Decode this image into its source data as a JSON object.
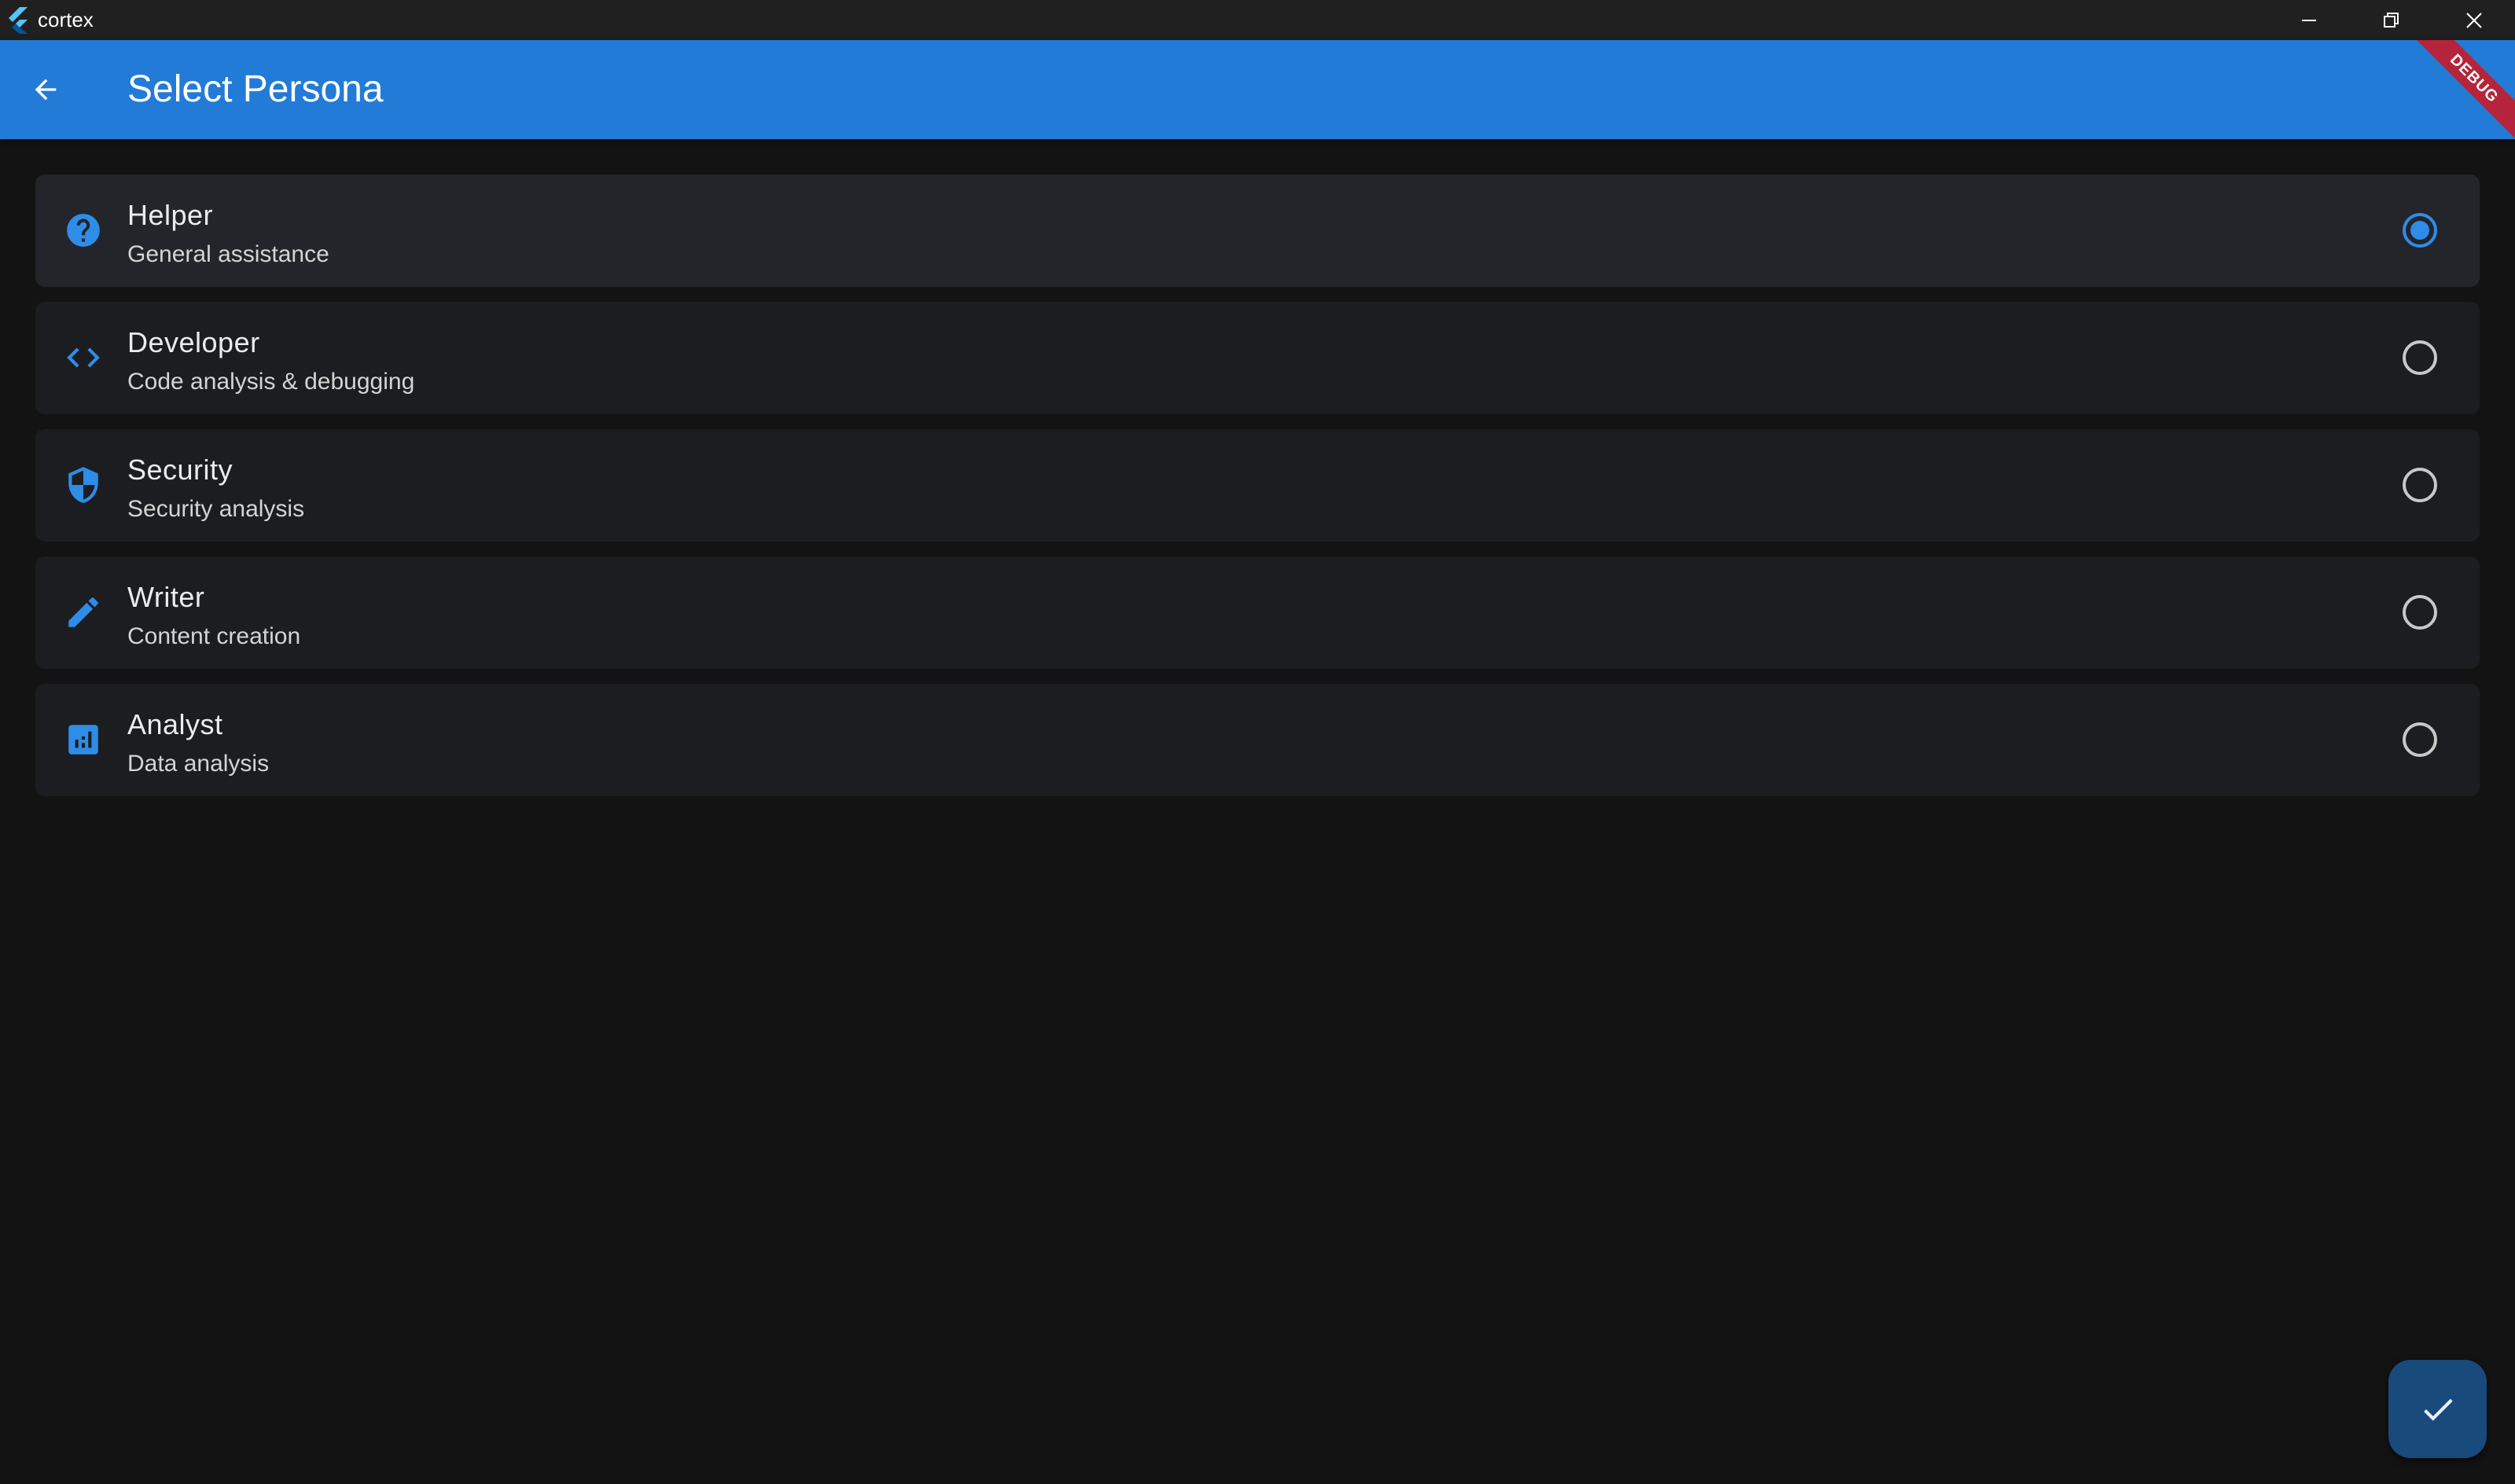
{
  "window": {
    "title": "cortex",
    "controls": [
      "minimize-icon",
      "restore-icon",
      "close-icon"
    ]
  },
  "appbar": {
    "title": "Select Persona",
    "back_icon": "arrow-back-icon",
    "debug_banner": "DEBUG",
    "color": "#227bd7"
  },
  "personas": [
    {
      "name": "Helper",
      "description": "General assistance",
      "icon": "help-circle-icon",
      "selected": true
    },
    {
      "name": "Developer",
      "description": "Code analysis & debugging",
      "icon": "code-icon",
      "selected": false
    },
    {
      "name": "Security",
      "description": "Security analysis",
      "icon": "shield-icon",
      "selected": false
    },
    {
      "name": "Writer",
      "description": "Content creation",
      "icon": "pencil-icon",
      "selected": false
    },
    {
      "name": "Analyst",
      "description": "Data analysis",
      "icon": "analytics-icon",
      "selected": false
    }
  ],
  "fab": {
    "icon": "check-icon"
  },
  "colors": {
    "accent": "#2e8de8",
    "background": "#131314",
    "card": "#1c1d21",
    "card_selected": "#23252a",
    "fab": "#184a7c"
  }
}
